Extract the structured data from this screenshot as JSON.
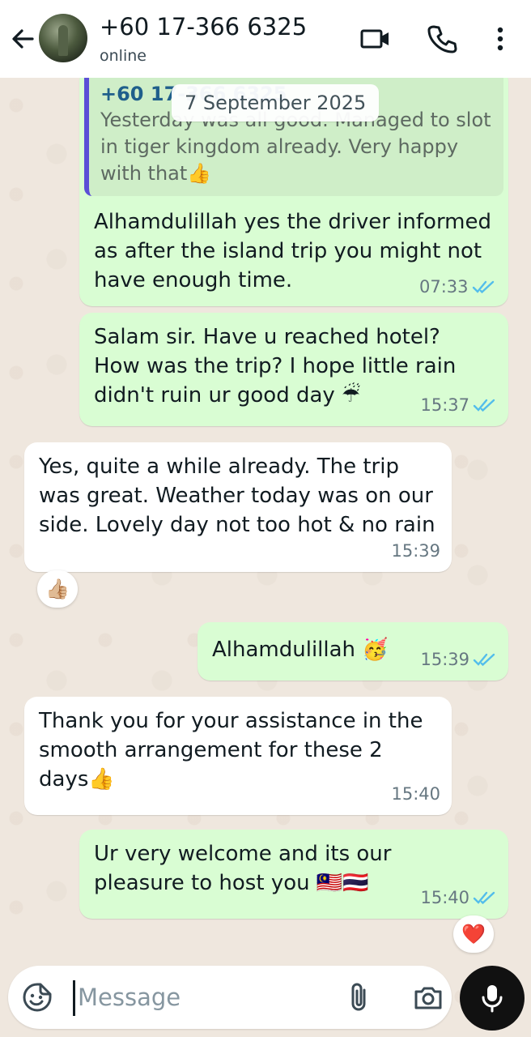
{
  "header": {
    "contact_name": "+60 17-366 6325",
    "status": "online"
  },
  "date_separator": "7 September 2025",
  "quoted": {
    "name": "+60 17-366 6325",
    "text": "Yesterday was all good. Managed to slot in tiger kingdom already. Very happy with that👍"
  },
  "messages": [
    {
      "direction": "out",
      "text": "Alhamdulillah yes the driver informed as after the island trip you might not have enough time.",
      "time": "07:33",
      "read": true
    },
    {
      "direction": "out",
      "text": "Salam sir. Have u reached hotel? How was the trip? I hope little rain didn't ruin ur good day ☔",
      "time": "15:37",
      "read": true
    },
    {
      "direction": "in",
      "text": "Yes, quite a while already. The trip was great. Weather today was on our side. Lovely day not too hot & no rain",
      "time": "15:39",
      "reaction": "👍🏼"
    },
    {
      "direction": "out",
      "text": "Alhamdulillah 🥳",
      "time": "15:39",
      "read": true
    },
    {
      "direction": "in",
      "text": "Thank you for your assistance in the smooth arrangement for these 2 days👍",
      "time": "15:40"
    },
    {
      "direction": "out",
      "text": "Ur very welcome and its our pleasure to host you 🇲🇾🇹🇭",
      "time": "15:40",
      "read": true,
      "reaction": "❤️"
    }
  ],
  "input": {
    "placeholder": "Message"
  },
  "colors": {
    "outgoing_bubble": "#d9fdd3",
    "incoming_bubble": "#ffffff",
    "read_ticks": "#53bdeb",
    "quote_bar": "#5b4fd6"
  },
  "icons": [
    "back-arrow-icon",
    "video-call-icon",
    "phone-icon",
    "more-vertical-icon",
    "sticker-icon",
    "paperclip-icon",
    "camera-icon",
    "microphone-icon"
  ]
}
